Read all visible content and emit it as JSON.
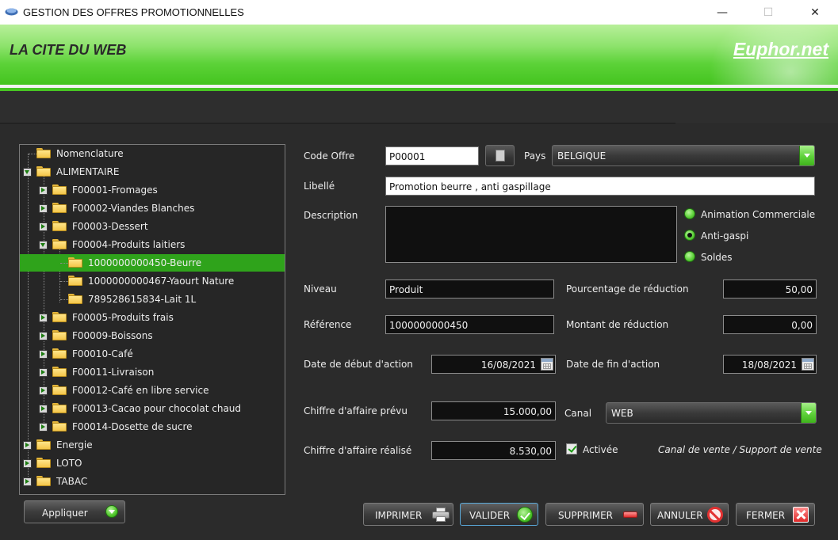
{
  "window": {
    "title": "GESTION DES OFFRES PROMOTIONNELLES",
    "minimize_glyph": "—",
    "maximize_glyph": "☐",
    "close_glyph": "✕"
  },
  "banner": {
    "company": "LA CITE DU WEB",
    "brand": "Euphor.net",
    "accent_color": "#47c423"
  },
  "tree": {
    "items": [
      {
        "label": "Nomenclature"
      },
      {
        "label": "ALIMENTAIRE"
      },
      {
        "label": "F00001-Fromages"
      },
      {
        "label": "F00002-Viandes Blanches"
      },
      {
        "label": "F00003-Dessert"
      },
      {
        "label": "F00004-Produits laitiers"
      },
      {
        "label": "1000000000450-Beurre"
      },
      {
        "label": "1000000000467-Yaourt Nature"
      },
      {
        "label": "789528615834-Lait 1L"
      },
      {
        "label": "F00005-Produits frais"
      },
      {
        "label": "F00009-Boissons"
      },
      {
        "label": "F00010-Café"
      },
      {
        "label": "F00011-Livraison"
      },
      {
        "label": "F00012-Café en libre service"
      },
      {
        "label": "F00013-Cacao pour chocolat chaud"
      },
      {
        "label": "F00014-Dosette de sucre"
      },
      {
        "label": "Energie"
      },
      {
        "label": "LOTO"
      },
      {
        "label": "TABAC"
      }
    ],
    "selected": "1000000000450-Beurre"
  },
  "form": {
    "code_offre_label": "Code Offre",
    "code_offre_value": "P00001",
    "pays_label": "Pays",
    "pays_value": "BELGIQUE",
    "libelle_label": "Libellé",
    "libelle_value": "Promotion beurre , anti gaspillage",
    "description_label": "Description",
    "description_value": "",
    "radio_options": [
      "Animation Commerciale",
      "Anti-gaspi",
      "Soldes"
    ],
    "radio_selected": "Anti-gaspi",
    "niveau_label": "Niveau",
    "niveau_value": "Produit",
    "pourcentage_label": "Pourcentage de réduction",
    "pourcentage_value": "50,00",
    "reference_label": "Référence",
    "reference_value": "1000000000450",
    "montant_label": "Montant de réduction",
    "montant_value": "0,00",
    "date_debut_label": "Date de début d'action",
    "date_debut_value": "16/08/2021",
    "date_fin_label": "Date de fin d'action",
    "date_fin_value": "18/08/2021",
    "ca_prevu_label": "Chiffre d'affaire prévu",
    "ca_prevu_value": "15.000,00",
    "canal_label": "Canal",
    "canal_value": "WEB",
    "ca_realise_label": "Chiffre d'affaire réalisé",
    "ca_realise_value": "8.530,00",
    "activee_label": "Activée",
    "activee_checked": true,
    "canal_note": "Canal de vente / Support de vente"
  },
  "buttons": {
    "appliquer": "Appliquer",
    "imprimer": "IMPRIMER",
    "valider": "VALIDER",
    "supprimer": "SUPPRIMER",
    "annuler": "ANNULER",
    "fermer": "FERMER"
  }
}
